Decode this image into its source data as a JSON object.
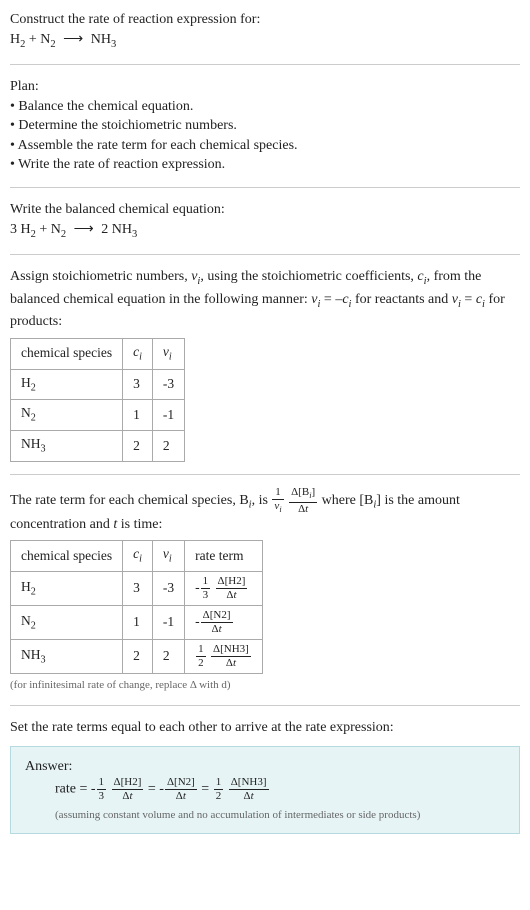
{
  "intro": {
    "prompt": "Construct the rate of reaction expression for:",
    "equation_lhs1": "H",
    "equation_lhs2": "N",
    "equation_rhs": "NH"
  },
  "plan": {
    "heading": "Plan:",
    "items": [
      "Balance the chemical equation.",
      "Determine the stoichiometric numbers.",
      "Assemble the rate term for each chemical species.",
      "Write the rate of reaction expression."
    ]
  },
  "balanced": {
    "intro": "Write the balanced chemical equation:",
    "coef_h2": "3",
    "coef_n2": "",
    "coef_nh3": "2"
  },
  "stoich": {
    "intro1": "Assign stoichiometric numbers, ",
    "intro2": ", using the stoichiometric coefficients, ",
    "intro3": ", from the balanced chemical equation in the following manner: ",
    "intro4": " for reactants and ",
    "intro5": " for products:",
    "headers": [
      "chemical species",
      "cᵢ",
      "νᵢ"
    ],
    "rows": [
      [
        "H₂",
        "3",
        "-3"
      ],
      [
        "N₂",
        "1",
        "-1"
      ],
      [
        "NH₃",
        "2",
        "2"
      ]
    ]
  },
  "rateterm": {
    "intro_a": "The rate term for each chemical species, B",
    "intro_b": ", is ",
    "intro_c": " where [B",
    "intro_d": "] is the amount concentration and ",
    "intro_e": " is time:",
    "headers": [
      "chemical species",
      "cᵢ",
      "νᵢ",
      "rate term"
    ],
    "rows": [
      {
        "sp": "H₂",
        "c": "3",
        "v": "-3",
        "sign": "-",
        "coef_num": "1",
        "coef_den": "3",
        "d": "Δ[H2]"
      },
      {
        "sp": "N₂",
        "c": "1",
        "v": "-1",
        "sign": "-",
        "coef_num": "",
        "coef_den": "",
        "d": "Δ[N2]"
      },
      {
        "sp": "NH₃",
        "c": "2",
        "v": "2",
        "sign": "",
        "coef_num": "1",
        "coef_den": "2",
        "d": "Δ[NH3]"
      }
    ],
    "note": "(for infinitesimal rate of change, replace Δ with d)"
  },
  "final": {
    "intro": "Set the rate terms equal to each other to arrive at the rate expression:",
    "answer_label": "Answer:",
    "rate_label": "rate = ",
    "caveat": "(assuming constant volume and no accumulation of intermediates or side products)"
  }
}
